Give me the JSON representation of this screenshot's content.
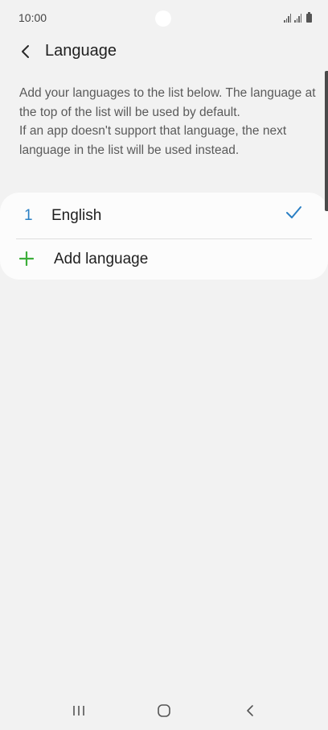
{
  "status_bar": {
    "time": "10:00"
  },
  "header": {
    "title": "Language",
    "back_icon": "chevron-left-icon"
  },
  "description": {
    "line1": "Add your languages to the list below. The language at the top of the list will be used by default.",
    "line2": "If an app doesn't support that language, the next language in the list will be used instead."
  },
  "languages": [
    {
      "index": "1",
      "name": "English",
      "selected": true
    }
  ],
  "add_language": {
    "label": "Add language",
    "icon": "plus-icon"
  },
  "colors": {
    "accent_blue": "#2a7fc4",
    "add_green": "#3dae3a",
    "background": "#f2f2f2",
    "card": "#fcfcfc"
  },
  "nav_bar": {
    "recents_icon": "recents-icon",
    "home_icon": "home-icon",
    "back_icon": "back-icon"
  }
}
